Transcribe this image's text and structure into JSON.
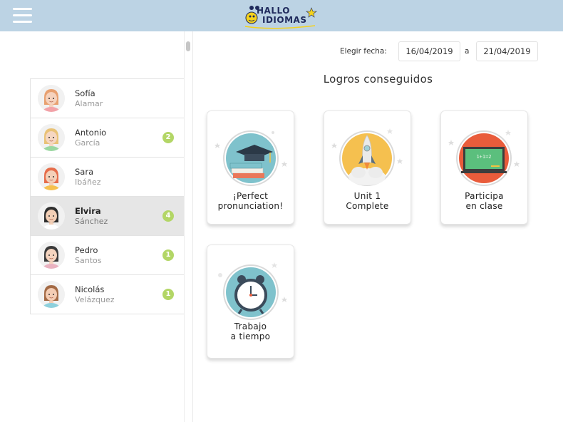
{
  "header": {
    "logo_line1": "HALLO",
    "logo_line2": "IDIOMAS",
    "bar_color": "#bcd3e4",
    "menu_icon": "hamburger-menu-icon"
  },
  "sidebar": {
    "students": [
      {
        "first": "Sofía",
        "last": "Alamar",
        "badge": null,
        "selected": false
      },
      {
        "first": "Antonio",
        "last": "García",
        "badge": "2",
        "selected": false
      },
      {
        "first": "Sara",
        "last": "Ibáñez",
        "badge": null,
        "selected": false
      },
      {
        "first": "Elvira",
        "last": "Sánchez",
        "badge": "4",
        "selected": true
      },
      {
        "first": "Pedro",
        "last": "Santos",
        "badge": "1",
        "selected": false
      },
      {
        "first": "Nicolás",
        "last": "Velázquez",
        "badge": "1",
        "selected": false
      }
    ],
    "badge_color": "#b3d666"
  },
  "filters": {
    "date_label": "Elegir fecha:",
    "from_date": "16/04/2019",
    "separator": "a",
    "to_date": "21/04/2019"
  },
  "achievements": {
    "title": "Logros conseguidos",
    "items": [
      {
        "label": "¡Perfect\npronunciation!",
        "icon": "graduation-cap-books-icon"
      },
      {
        "label": "Unit 1\nComplete",
        "icon": "rocket-icon"
      },
      {
        "label": "Participa\nen clase",
        "icon": "chalkboard-icon"
      },
      {
        "label": "Trabajo\na tiempo",
        "icon": "alarm-clock-icon"
      }
    ]
  }
}
